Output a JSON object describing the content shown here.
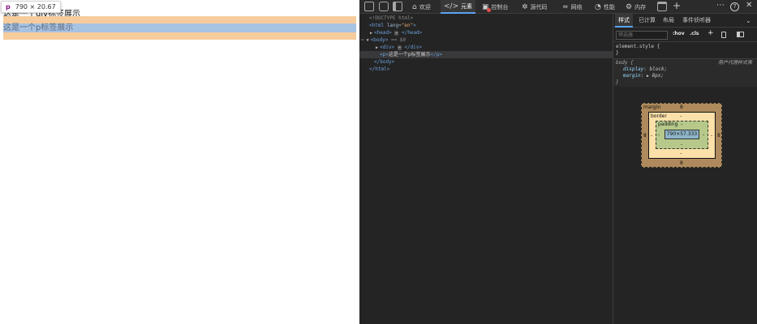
{
  "viewport": {
    "tooltip_tag": "p",
    "tooltip_size": "790 × 20.67",
    "div_text": "这是一个div标签展示",
    "p_text": "这是一个p标签展示"
  },
  "devtools": {
    "tabs": [
      {
        "label": "欢迎",
        "icon": "home-icon"
      },
      {
        "label": "元素",
        "icon": "code-icon"
      },
      {
        "label": "控制台",
        "icon": "console-icon"
      },
      {
        "label": "源代码",
        "icon": "bug-icon"
      },
      {
        "label": "网络",
        "icon": "wifi-icon"
      },
      {
        "label": "性能",
        "icon": "performance-icon"
      },
      {
        "label": "内存",
        "icon": "gear-icon"
      }
    ],
    "add_tab": "+",
    "more": "⋯",
    "help": "?",
    "close": "✕",
    "dom": {
      "doctype": "<!DOCTYPE html>",
      "html_open": "<html",
      "html_attr_name": "lang",
      "html_attr_val": "\"en\"",
      "head": "<head>",
      "head_close": "</head>",
      "body": "<body>",
      "body_ref": "== $0",
      "div": "<div>",
      "div_close": "</div>",
      "p_open": "<p>",
      "p_text": "这是一个p标签展示",
      "p_close": "</p>",
      "body_close": "</body>",
      "html_close": "</html>",
      "ellipsis": "⋯",
      "gutter_dots": "⋯"
    },
    "styles": {
      "tabs": [
        "样式",
        "已计算",
        "布局",
        "事件侦听器"
      ],
      "filter_placeholder": "筛选器",
      "hov": ":hov",
      "cls": ".cls",
      "element_style": "element.style {",
      "close_brace": "}",
      "body_selector": "body {",
      "ua_label": "用户代理样式表",
      "decl_display_prop": "display",
      "decl_display_val": "block;",
      "decl_margin_prop": "margin",
      "decl_margin_val": "8px;"
    },
    "box_model": {
      "margin_label": "margin",
      "margin_top": "8",
      "margin_bottom": "8",
      "margin_left": "8",
      "margin_right": "8",
      "border_label": "border",
      "border_value": "-",
      "padding_label": "padding",
      "padding_value": "-",
      "content": "790×57.333"
    }
  }
}
